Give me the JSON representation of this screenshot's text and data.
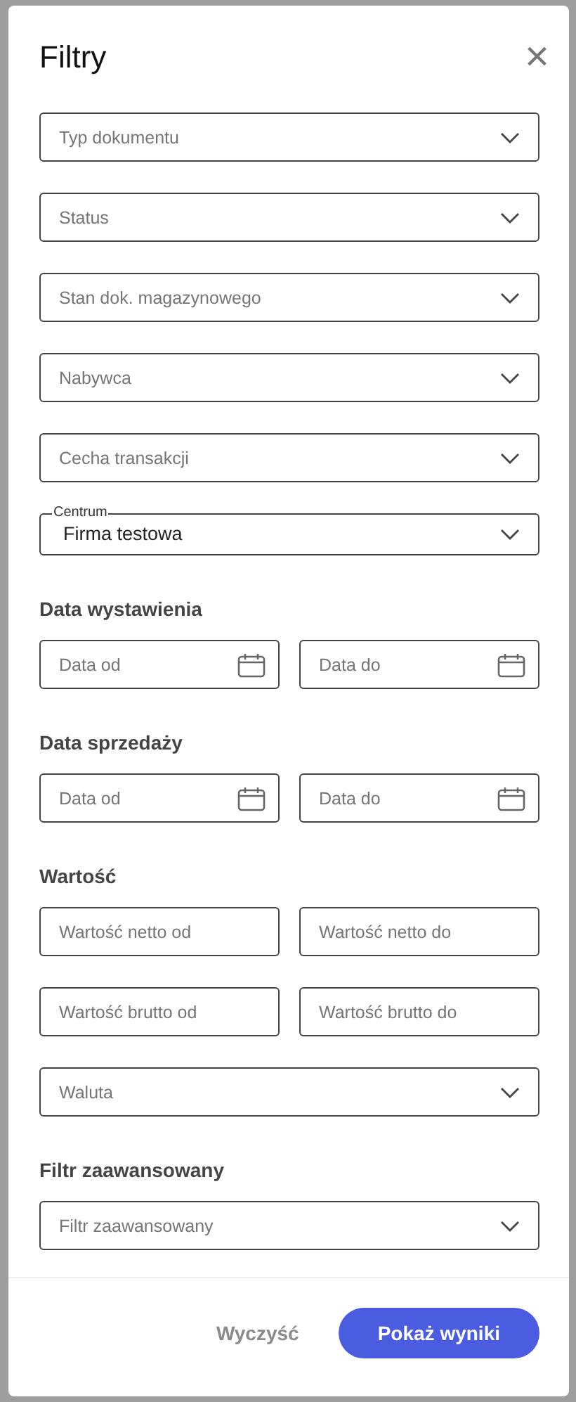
{
  "dialog": {
    "title": "Filtry",
    "close": "×"
  },
  "items": [
    {
      "kind": "select",
      "placeholder": "Typ dokumentu"
    },
    {
      "kind": "select",
      "placeholder": "Status"
    },
    {
      "kind": "select",
      "placeholder": "Stan dok. magazynowego"
    },
    {
      "kind": "select",
      "placeholder": "Nabywca"
    },
    {
      "kind": "select",
      "placeholder": "Cecha transakcji"
    },
    {
      "kind": "select_value",
      "label": "Centrum",
      "value": "Firma testowa"
    },
    {
      "kind": "heading",
      "text": "Data wystawienia"
    },
    {
      "kind": "pair",
      "fields": [
        {
          "kind": "date",
          "placeholder": "Data od"
        },
        {
          "kind": "date",
          "placeholder": "Data do"
        }
      ]
    },
    {
      "kind": "heading",
      "text": "Data sprzedaży"
    },
    {
      "kind": "pair",
      "fields": [
        {
          "kind": "date",
          "placeholder": "Data od"
        },
        {
          "kind": "date",
          "placeholder": "Data do"
        }
      ]
    },
    {
      "kind": "heading",
      "text": "Wartość"
    },
    {
      "kind": "pair",
      "fields": [
        {
          "kind": "text",
          "placeholder": "Wartość netto od"
        },
        {
          "kind": "text",
          "placeholder": "Wartość netto do"
        }
      ]
    },
    {
      "kind": "pair",
      "fields": [
        {
          "kind": "text",
          "placeholder": "Wartość brutto od"
        },
        {
          "kind": "text",
          "placeholder": "Wartość brutto do"
        }
      ]
    },
    {
      "kind": "select",
      "placeholder": "Waluta"
    },
    {
      "kind": "heading",
      "text": "Filtr zaawansowany"
    },
    {
      "kind": "select",
      "placeholder": "Filtr zaawansowany"
    }
  ],
  "buttons": [
    {
      "kind": "text",
      "label": "Wyczyść"
    },
    {
      "kind": "primary",
      "label": "Pokaż wyniki"
    }
  ]
}
